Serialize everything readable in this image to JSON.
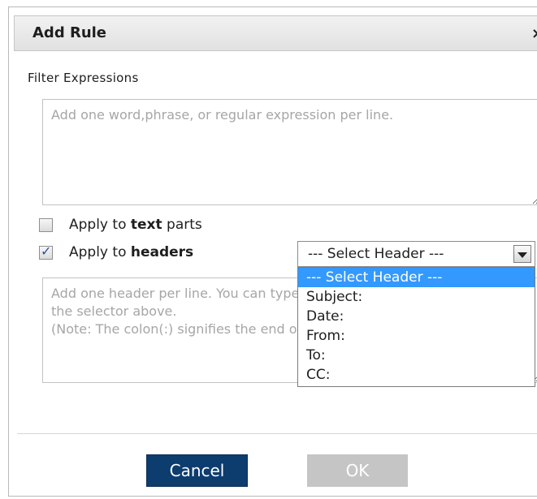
{
  "dialog": {
    "title": "Add Rule",
    "close_glyph": "×"
  },
  "filter": {
    "section_label": "Filter Expressions",
    "placeholder": "Add one word,phrase, or regular expression per line.",
    "value": ""
  },
  "options": {
    "text_parts": {
      "checked": false,
      "prefix": "Apply to ",
      "bold": "text",
      "suffix": " parts"
    },
    "headers": {
      "checked": true,
      "prefix": "Apply to ",
      "bold": "headers"
    }
  },
  "header_select": {
    "selected": "--- Select Header ---",
    "options": [
      "--- Select Header ---",
      "Subject:",
      "Date:",
      "From:",
      "To:",
      "CC:"
    ],
    "highlighted_index": 0,
    "expanded": true
  },
  "headers_textarea": {
    "placeholder": "Add one header per line. You can type or select predefined headers in the selector above.\n(Note: The colon(:) signifies the end of the header name.)",
    "value": ""
  },
  "buttons": {
    "cancel": "Cancel",
    "ok": "OK"
  },
  "icons": {
    "close": "close-icon",
    "dropdown": "chevron-down-icon",
    "check": "check-icon"
  },
  "colors": {
    "cancel_bg": "#0d3c6e",
    "ok_disabled_bg": "#c5c5c5",
    "highlight": "#3399ff"
  }
}
